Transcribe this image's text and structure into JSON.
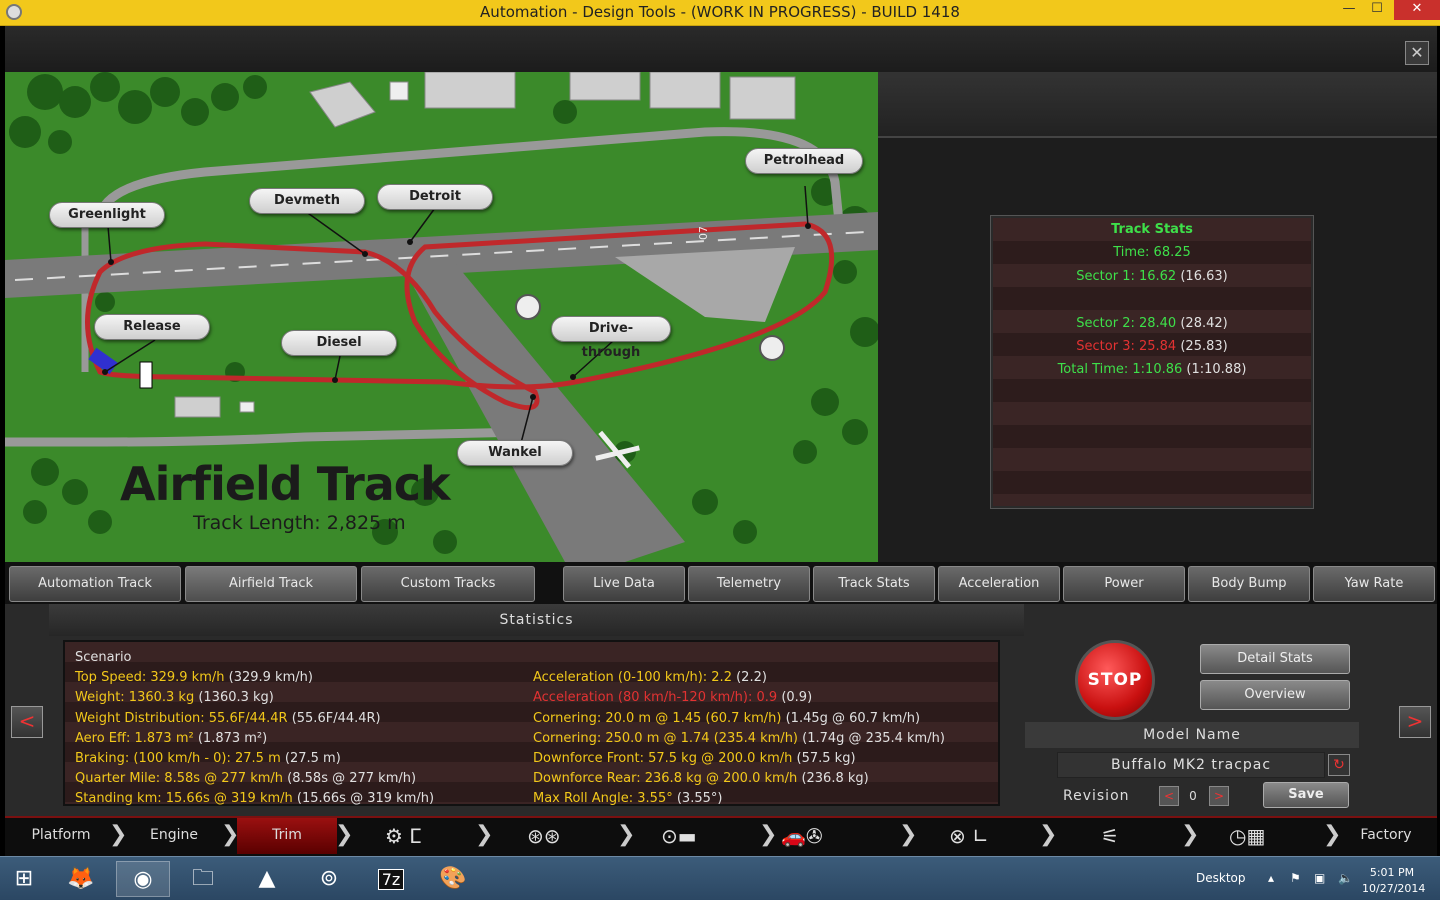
{
  "window": {
    "title": "Automation - Design Tools - (WORK IN PROGRESS) - BUILD 1418",
    "minimize": "—",
    "maximize": "☐",
    "close": "✕"
  },
  "panel_close": "✕",
  "map": {
    "title": "Airfield Track",
    "length": "Track Length: 2,825 m",
    "runway_marking": "07",
    "callouts": {
      "greenlight": "Greenlight",
      "devmeth": "Devmeth",
      "detroit": "Detroit",
      "petrolhead": "Petrolhead",
      "release": "Release",
      "diesel": "Diesel",
      "drive_through": "Drive-through",
      "wankel": "Wankel"
    }
  },
  "track_stats": {
    "title": "Track Stats",
    "time_label": "Time: 68.25",
    "sector1": "Sector 1: 16.62",
    "sector1_ref": " (16.63)",
    "sector2": "Sector 2: 28.40",
    "sector2_ref": " (28.42)",
    "sector3": "Sector 3: 25.84",
    "sector3_ref": " (25.83)",
    "total": "Total Time: 1:10.86",
    "total_ref": " (1:10.88)"
  },
  "tabs": {
    "automation_track": "Automation Track",
    "airfield_track": "Airfield Track",
    "custom_tracks": "Custom Tracks",
    "live_data": "Live Data",
    "telemetry": "Telemetry",
    "track_stats": "Track Stats",
    "acceleration": "Acceleration",
    "power": "Power",
    "body_bump": "Body Bump",
    "yaw_rate": "Yaw Rate"
  },
  "statistics": {
    "header": "Statistics",
    "scenario": "Scenario",
    "left": [
      {
        "label": "Top Speed: 329.9 km/h",
        "ref": " (329.9 km/h)"
      },
      {
        "label": "Weight: 1360.3 kg",
        "ref": " (1360.3 kg)"
      },
      {
        "label": "Weight Distribution: 55.6F/44.4R",
        "ref": " (55.6F/44.4R)"
      },
      {
        "label": "Aero Eff: 1.873 m²",
        "ref": " (1.873 m²)"
      },
      {
        "label": "Braking: (100 km/h - 0): 27.5 m",
        "ref": " (27.5 m)"
      },
      {
        "label": "Quarter Mile: 8.58s @ 277 km/h",
        "ref": " (8.58s @ 277 km/h)"
      },
      {
        "label": "Standing km: 15.66s @ 319 km/h",
        "ref": " (15.66s @ 319 km/h)"
      }
    ],
    "right": [
      {
        "label": "Acceleration (0-100 km/h): 2.2",
        "ref": " (2.2)",
        "color": "yellow"
      },
      {
        "label": "Acceleration (80 km/h-120 km/h): 0.9",
        "ref": " (0.9)",
        "color": "red"
      },
      {
        "label": "Cornering: 20.0 m @ 1.45 (60.7 km/h)",
        "ref": " (1.45g @ 60.7 km/h)",
        "color": "yellow"
      },
      {
        "label": "Cornering: 250.0 m @ 1.74 (235.4 km/h)",
        "ref": " (1.74g @ 235.4 km/h)",
        "color": "yellow"
      },
      {
        "label": "Downforce Front: 57.5 kg @ 200.0 km/h",
        "ref": " (57.5 kg)",
        "color": "yellow"
      },
      {
        "label": "Downforce Rear: 236.8 kg @ 200.0 km/h",
        "ref": " (236.8 kg)",
        "color": "yellow"
      },
      {
        "label": "Max Roll Angle: 3.55°",
        "ref": " (3.55°)",
        "color": "yellow"
      }
    ]
  },
  "controls": {
    "stop": "STOP",
    "detail_stats": "Detail Stats",
    "overview": "Overview",
    "model_label": "Model Name",
    "model_name": "Buffalo MK2 tracpac",
    "revision_label": "Revision",
    "revision_value": "0",
    "rev_prev": "<",
    "rev_next": ">",
    "save": "Save",
    "prev_page": "<",
    "next_page": ">"
  },
  "bottom_nav": {
    "platform": "Platform",
    "engine": "Engine",
    "trim": "Trim",
    "factory": "Factory"
  },
  "taskbar": {
    "desktop": "Desktop",
    "time": "5:01 PM",
    "date": "10/27/2014",
    "sevenzip": "7z"
  },
  "colors": {
    "accent_yellow": "#f2c81b",
    "stat_green": "#3ee04a",
    "stat_red": "#e33232",
    "track_red": "#c0282b",
    "grass": "#3b8a2a"
  }
}
